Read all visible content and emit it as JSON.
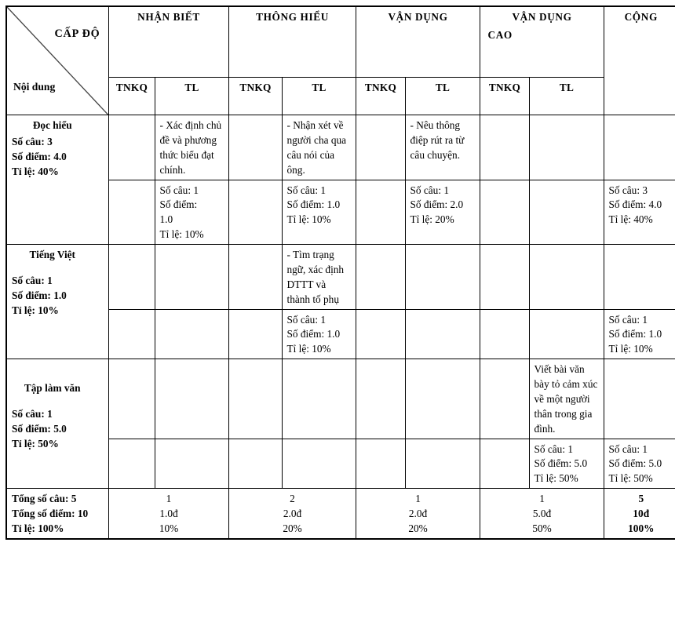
{
  "header": {
    "corner": {
      "level_label": "CẤP ĐỘ",
      "content_label": "Nội dung"
    },
    "levels": [
      {
        "label": "NHẬN BIẾT"
      },
      {
        "label": "THÔNG HIỂU"
      },
      {
        "label": "VẬN DỤNG"
      },
      {
        "label": "VẬN DỤNG",
        "label2": "CAO"
      }
    ],
    "total_label": "CỘNG",
    "sub": {
      "tnkq": "TNKQ",
      "tl": "TL"
    }
  },
  "rows": [
    {
      "name": "Đọc hiểu",
      "so_cau": "Số câu: 3",
      "so_diem": "Số điểm: 4.0",
      "ti_le": "Tỉ lệ: 40%",
      "desc": {
        "nb_tnkq": "",
        "nb_tl": "- Xác định chủ đề và phương thức biểu đạt chính.",
        "th_tnkq": "",
        "th_tl": "- Nhận xét về người cha qua câu nói của ông.",
        "vd_tnkq": "",
        "vd_tl": "- Nêu thông điệp rút ra từ câu chuyện.",
        "vdc_tnkq": "",
        "vdc_tl": "",
        "cong": ""
      },
      "stats": {
        "nb_tnkq": [],
        "nb_tl": [
          "Số câu: 1",
          "Số điểm:",
          "1.0",
          "Tỉ lệ: 10%"
        ],
        "th_tnkq": [],
        "th_tl": [
          "Số câu: 1",
          "Số điểm: 1.0",
          "Tỉ lệ: 10%"
        ],
        "vd_tnkq": [],
        "vd_tl": [
          "Số câu: 1",
          "Số điểm: 2.0",
          "Tỉ lệ: 20%"
        ],
        "vdc_tnkq": [],
        "vdc_tl": [],
        "cong": [
          "Số câu: 3",
          "Số điểm: 4.0",
          "Tỉ lệ: 40%"
        ]
      }
    },
    {
      "name": "Tiếng Việt",
      "so_cau": "Số câu: 1",
      "so_diem": "Số điểm: 1.0",
      "ti_le": "Tỉ lệ: 10%",
      "desc": {
        "nb_tnkq": "",
        "nb_tl": "",
        "th_tnkq": "",
        "th_tl": "- Tìm trạng ngữ, xác định DTTT và thành tố phụ",
        "vd_tnkq": "",
        "vd_tl": "",
        "vdc_tnkq": "",
        "vdc_tl": "",
        "cong": ""
      },
      "stats": {
        "nb_tnkq": [],
        "nb_tl": [],
        "th_tnkq": [],
        "th_tl": [
          "Số câu: 1",
          "Số điểm: 1.0",
          "Tỉ lệ: 10%"
        ],
        "vd_tnkq": [],
        "vd_tl": [],
        "vdc_tnkq": [],
        "vdc_tl": [],
        "cong": [
          "Số câu: 1",
          "Số điểm: 1.0",
          "Tỉ lệ: 10%"
        ]
      }
    },
    {
      "name": "Tập làm văn",
      "so_cau": "Số câu: 1",
      "so_diem": "Số điểm: 5.0",
      "ti_le": "Tỉ lệ: 50%",
      "desc": {
        "nb_tnkq": "",
        "nb_tl": "",
        "th_tnkq": "",
        "th_tl": "",
        "vd_tnkq": "",
        "vd_tl": "",
        "vdc_tnkq": "",
        "vdc_tl": "Viết bài văn bày tỏ cảm xúc về một người thân trong gia đình.",
        "cong": ""
      },
      "stats": {
        "nb_tnkq": [],
        "nb_tl": [],
        "th_tnkq": [],
        "th_tl": [],
        "vd_tnkq": [],
        "vd_tl": [],
        "vdc_tnkq": [],
        "vdc_tl": [
          "Số câu: 1",
          "Số điểm: 5.0",
          "Tỉ lệ: 50%"
        ],
        "cong": [
          "Số câu: 1",
          "Số điểm: 5.0",
          "Tỉ lệ: 50%"
        ]
      }
    }
  ],
  "totals": {
    "label_cau": "Tổng số câu: 5",
    "label_diem": "Tổng số điểm: 10",
    "label_tile": "Tỉ lệ: 100%",
    "columns": [
      {
        "cau": "1",
        "diem": "1.0đ",
        "tile": "10%"
      },
      {
        "cau": "2",
        "diem": "2.0đ",
        "tile": "20%"
      },
      {
        "cau": "1",
        "diem": "2.0đ",
        "tile": "20%"
      },
      {
        "cau": "1",
        "diem": "5.0đ",
        "tile": "50%"
      }
    ],
    "grand": {
      "cau": "5",
      "diem": "10đ",
      "tile": "100%"
    }
  }
}
